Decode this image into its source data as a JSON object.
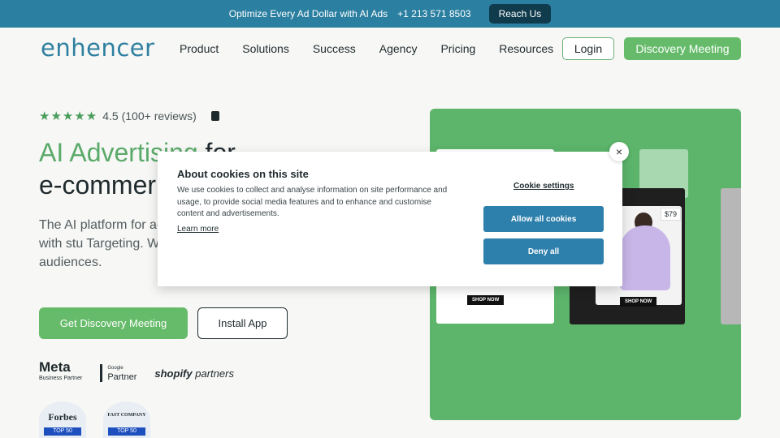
{
  "topbar": {
    "promo": "Optimize Every Ad Dollar with AI Ads",
    "phone": "+1 213 571 8503",
    "reach_label": "Reach Us"
  },
  "header": {
    "logo": "enhencer",
    "nav": [
      "Product",
      "Solutions",
      "Success",
      "Agency",
      "Pricing",
      "Resources"
    ],
    "login_label": "Login",
    "discovery_label": "Discovery Meeting"
  },
  "hero": {
    "stars": "★★★★★",
    "rating_text": "4.5 (100+ reviews)",
    "title_green": "AI Advertising",
    "title_dark": " for",
    "title_line2": "e-commer",
    "subtitle": "The AI platform for advertising with stu Targeting. Without audiences.",
    "primary_btn": "Get Discovery Meeting",
    "secondary_btn": "Install App"
  },
  "partners": {
    "meta": "Meta",
    "meta_sub": "Business Partner",
    "google_top": "Google",
    "google": "Partner",
    "shopify": "shopify",
    "shopify_sub": "partners"
  },
  "badges": [
    {
      "title": "Forbes",
      "ribbon": "TOP 50"
    },
    {
      "title": "FAST COMPANY",
      "ribbon": "TOP 50"
    }
  ],
  "ads": {
    "shop_now": "SHOP NOW",
    "price": "$79"
  },
  "cookie": {
    "title": "About cookies on this site",
    "body": "We use cookies to collect and analyse information on site performance and usage, to provide social media features and to enhance and customise content and advertisements.",
    "learn_more": "Learn more",
    "settings": "Cookie settings",
    "allow_all": "Allow all cookies",
    "deny_all": "Deny all",
    "close": "×"
  }
}
